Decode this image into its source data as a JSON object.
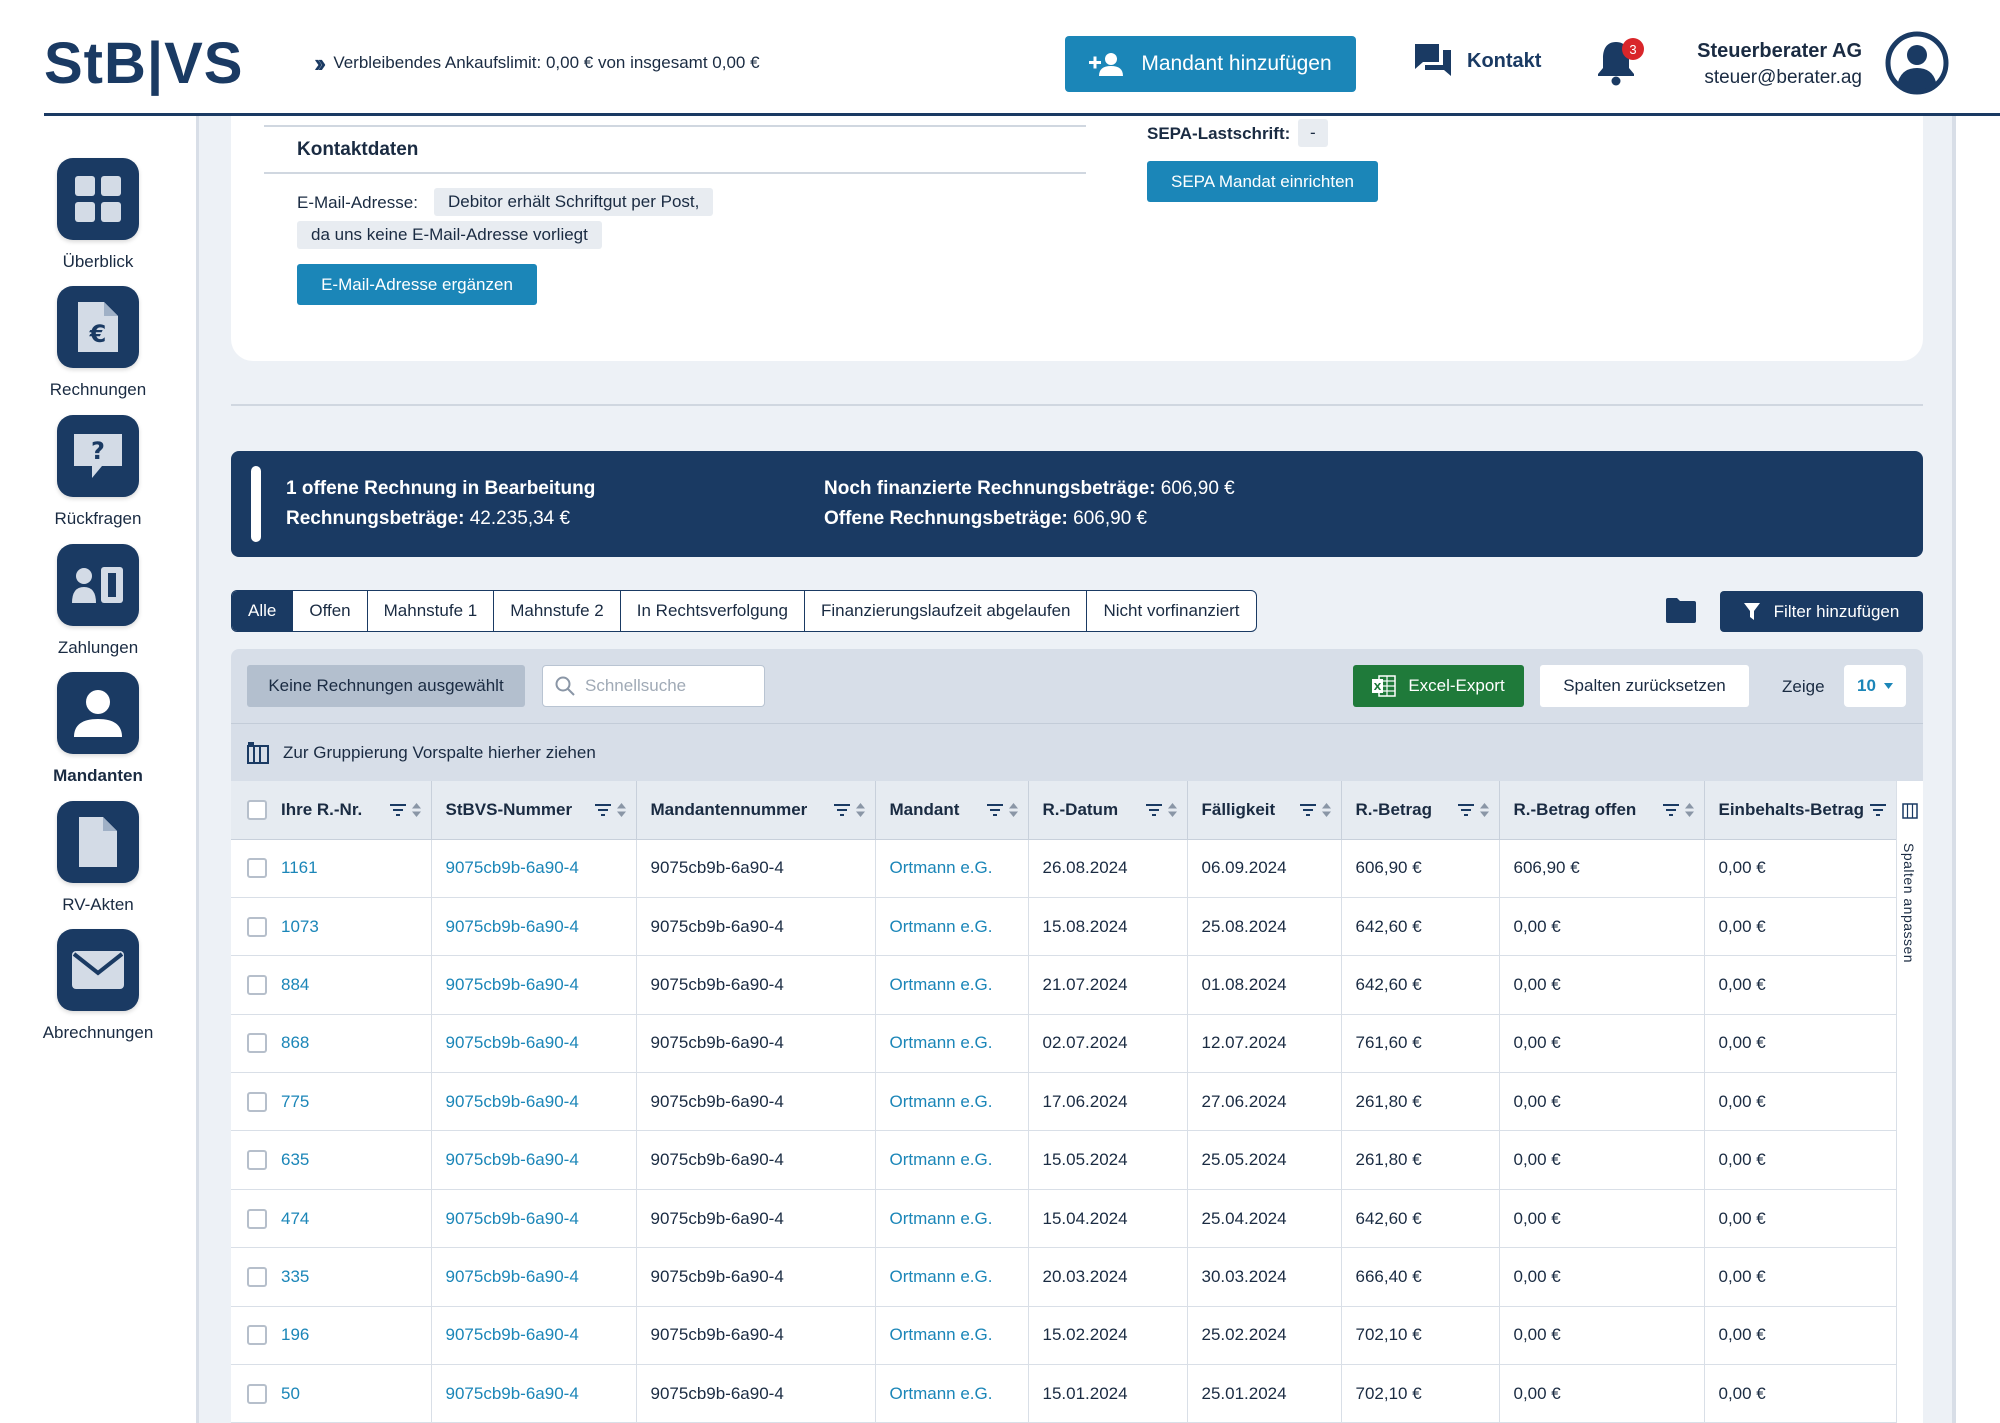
{
  "header": {
    "logo": "StB|VS",
    "limit_text": "Verbleibendes Ankaufslimit: 0,00 € von insgesamt 0,00 €",
    "add_client_label": "Mandant hinzufügen",
    "contact_label": "Kontakt",
    "notification_count": "3",
    "user_company": "Steuerberater AG",
    "user_email": "steuer@berater.ag"
  },
  "sidebar": {
    "items": [
      {
        "label": "Überblick",
        "icon": "dashboard-grid-icon"
      },
      {
        "label": "Rechnungen",
        "icon": "invoice-euro-icon"
      },
      {
        "label": "Rückfragen",
        "icon": "question-chat-icon"
      },
      {
        "label": "Zahlungen",
        "icon": "payments-icon"
      },
      {
        "label": "Mandanten",
        "icon": "client-person-icon",
        "active": true
      },
      {
        "label": "RV-Akten",
        "icon": "document-icon"
      },
      {
        "label": "Abrechnungen",
        "icon": "envelope-icon"
      }
    ]
  },
  "contact_card": {
    "title": "Kontaktdaten",
    "email_label": "E-Mail-Adresse:",
    "email_value_line1": "Debitor erhält Schriftgut per Post,",
    "email_value_line2": "da uns keine E-Mail-Adresse vorliegt",
    "add_email_button": "E-Mail-Adresse ergänzen",
    "sepa_label": "SEPA-Lastschrift:",
    "sepa_value": "-",
    "sepa_button": "SEPA Mandat einrichten"
  },
  "summary": {
    "open_invoices": "1 offene Rechnung in Bearbeitung",
    "invoice_amounts_label": "Rechnungsbeträge:",
    "invoice_amounts_value": "42.235,34 €",
    "financed_label": "Noch finanzierte Rechnungsbeträge:",
    "financed_value": "606,90 €",
    "open_label": "Offene Rechnungsbeträge:",
    "open_value": "606,90 €"
  },
  "tabs": [
    "Alle",
    "Offen",
    "Mahnstufe 1",
    "Mahnstufe 2",
    "In Rechtsverfolgung",
    "Finanzierungslaufzeit abgelaufen",
    "Nicht vorfinanziert"
  ],
  "filter_button": "Filter hinzufügen",
  "toolbar": {
    "no_selection": "Keine Rechnungen ausgewählt",
    "search_placeholder": "Schnellsuche",
    "excel_export": "Excel-Export",
    "reset_columns": "Spalten zurücksetzen",
    "show_label": "Zeige",
    "page_size": "10"
  },
  "grouping_text": "Zur Gruppierung Vorspalte hierher ziehen",
  "columns_adjust_label": "Spalten anpassen",
  "colors": {
    "navy": "#1a3a63",
    "accent_blue": "#1b86b8",
    "excel_green": "#1f7a3a",
    "badge_red": "#d9262a"
  },
  "table": {
    "columns": [
      "Ihre R.-Nr.",
      "StBVS-Nummer",
      "Mandantennummer",
      "Mandant",
      "R.-Datum",
      "Fälligkeit",
      "R.-Betrag",
      "R.-Betrag offen",
      "Einbehalts-Betrag"
    ],
    "rows": [
      [
        "1161",
        "9075cb9b-6a90-4",
        "9075cb9b-6a90-4",
        "Ortmann e.G.",
        "26.08.2024",
        "06.09.2024",
        "606,90 €",
        "606,90 €",
        "0,00 €"
      ],
      [
        "1073",
        "9075cb9b-6a90-4",
        "9075cb9b-6a90-4",
        "Ortmann e.G.",
        "15.08.2024",
        "25.08.2024",
        "642,60 €",
        "0,00 €",
        "0,00 €"
      ],
      [
        "884",
        "9075cb9b-6a90-4",
        "9075cb9b-6a90-4",
        "Ortmann e.G.",
        "21.07.2024",
        "01.08.2024",
        "642,60 €",
        "0,00 €",
        "0,00 €"
      ],
      [
        "868",
        "9075cb9b-6a90-4",
        "9075cb9b-6a90-4",
        "Ortmann e.G.",
        "02.07.2024",
        "12.07.2024",
        "761,60 €",
        "0,00 €",
        "0,00 €"
      ],
      [
        "775",
        "9075cb9b-6a90-4",
        "9075cb9b-6a90-4",
        "Ortmann e.G.",
        "17.06.2024",
        "27.06.2024",
        "261,80 €",
        "0,00 €",
        "0,00 €"
      ],
      [
        "635",
        "9075cb9b-6a90-4",
        "9075cb9b-6a90-4",
        "Ortmann e.G.",
        "15.05.2024",
        "25.05.2024",
        "261,80 €",
        "0,00 €",
        "0,00 €"
      ],
      [
        "474",
        "9075cb9b-6a90-4",
        "9075cb9b-6a90-4",
        "Ortmann e.G.",
        "15.04.2024",
        "25.04.2024",
        "642,60 €",
        "0,00 €",
        "0,00 €"
      ],
      [
        "335",
        "9075cb9b-6a90-4",
        "9075cb9b-6a90-4",
        "Ortmann e.G.",
        "20.03.2024",
        "30.03.2024",
        "666,40 €",
        "0,00 €",
        "0,00 €"
      ],
      [
        "196",
        "9075cb9b-6a90-4",
        "9075cb9b-6a90-4",
        "Ortmann e.G.",
        "15.02.2024",
        "25.02.2024",
        "702,10 €",
        "0,00 €",
        "0,00 €"
      ],
      [
        "50",
        "9075cb9b-6a90-4",
        "9075cb9b-6a90-4",
        "Ortmann e.G.",
        "15.01.2024",
        "25.01.2024",
        "702,10 €",
        "0,00 €",
        "0,00 €"
      ]
    ]
  }
}
